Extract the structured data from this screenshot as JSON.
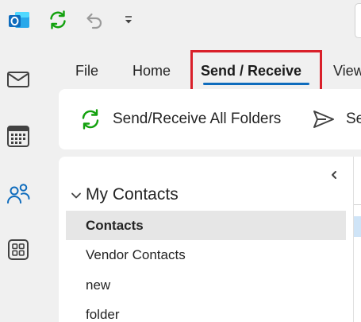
{
  "titlebar": {
    "icons": [
      "outlook-logo-icon",
      "sync-icon",
      "undo-icon",
      "customize-qat-icon"
    ],
    "colors": {
      "outlook_blue": "#0f6cbd",
      "sync_green": "#13a10e"
    }
  },
  "rail": {
    "items": [
      "mail-icon",
      "calendar-icon",
      "people-icon",
      "apps-icon"
    ],
    "active_color": "#0f6cbd"
  },
  "ribbon": {
    "tabs": [
      {
        "label": "File"
      },
      {
        "label": "Home"
      },
      {
        "label": "Send / Receive",
        "selected": true
      },
      {
        "label": "View"
      }
    ],
    "highlight_color": "#d9202a",
    "commands": [
      {
        "label": "Send/Receive All Folders",
        "icon": "sync-icon"
      },
      {
        "label": "Se",
        "icon": "send-icon"
      }
    ]
  },
  "folder_pane": {
    "section_title": "My Contacts",
    "items": [
      {
        "label": "Contacts",
        "selected": true
      },
      {
        "label": "Vendor Contacts"
      },
      {
        "label": "new"
      },
      {
        "label": "folder"
      }
    ]
  }
}
